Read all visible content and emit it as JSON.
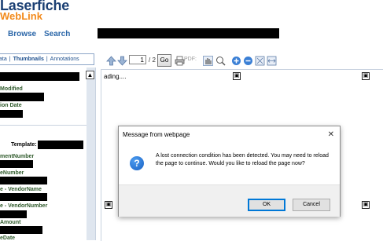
{
  "header": {
    "logo_main": "Laserfiche",
    "logo_sub": "WebLink",
    "nav": {
      "browse": "Browse",
      "search": "Search"
    }
  },
  "left_tabs": {
    "items": [
      "ata",
      "Thumbnails",
      "Annotations"
    ],
    "separator": "|"
  },
  "metadata": {
    "fields": [
      "Modified",
      "ion Date",
      "Template:",
      "mentNumber",
      "eNumber",
      "e - VendorName",
      "e - VendorNumber",
      "Amount",
      "eDate"
    ],
    "collapse_symbol": "▲"
  },
  "toolbar": {
    "page_value": "1",
    "page_of": "/ 2",
    "go_label": "Go",
    "pdf_label": "PDF:"
  },
  "viewer": {
    "loading_text": "ading....",
    "placeholder_symbol": "▣"
  },
  "dialog": {
    "title": "Message from webpage",
    "close_symbol": "✕",
    "icon_symbol": "?",
    "message": "A lost connection condition has been detected. You may need to reload the page to continue.  Would you like to reload the page now?",
    "ok_label": "OK",
    "cancel_label": "Cancel"
  },
  "colors": {
    "logo_blue": "#1b3f73",
    "logo_orange": "#f28a1c",
    "link_blue": "#2a66a8",
    "field_green": "#2f5a2b",
    "ok_border": "#0078d7"
  }
}
